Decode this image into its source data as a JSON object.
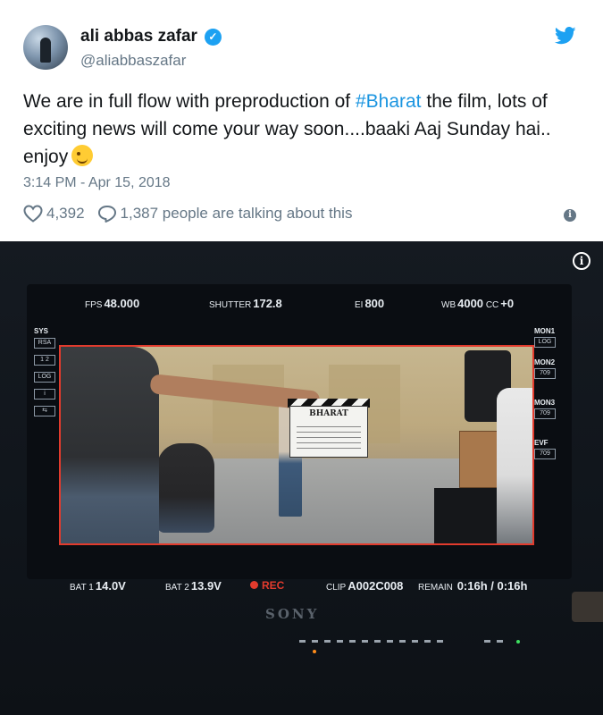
{
  "tweet": {
    "author_name": "ali abbas zafar",
    "handle": "@aliabbaszafar",
    "verified_mark": "✓",
    "text_before": "We are in full flow with preproduction of ",
    "hashtag": "#Bharat",
    "text_after": " the film, lots of exciting news will come your way soon....baaki Aaj Sunday hai.. enjoy",
    "emoji": "winking-face",
    "timestamp": "3:14 PM - Apr 15, 2018",
    "like_count": "4,392",
    "reply_text": "1,387 people are talking about this",
    "info_glyph": "i"
  },
  "photo": {
    "info_glyph": "i",
    "hud_top": {
      "fps_label": "FPS",
      "fps_value": "48.000",
      "shutter_label": "SHUTTER",
      "shutter_value": "172.8",
      "ei_label": "EI",
      "ei_value": "800",
      "wb_label": "WB",
      "wb_value": "4000",
      "cc_label": "CC",
      "cc_value": "+0"
    },
    "side_left": {
      "label": "SYS",
      "boxes": [
        "RSA",
        "1 2",
        "LOG",
        "i",
        "⇆"
      ]
    },
    "side_right": {
      "items": [
        {
          "label": "MON1",
          "box": "LOG"
        },
        {
          "label": "MON2",
          "box": "709"
        },
        {
          "label": "MON3",
          "box": "709"
        },
        {
          "label": "EVF",
          "box": "709"
        }
      ]
    },
    "clapper_title": "BHARAT",
    "hud_bottom": {
      "bat1_label": "BAT 1",
      "bat1_value": "14.0V",
      "bat2_label": "BAT 2",
      "bat2_value": "13.9V",
      "rec_label": "REC",
      "clip_label": "CLIP",
      "clip_value": "A002C008",
      "remain_label": "REMAIN",
      "remain_value": "0:16h / 0:16h"
    },
    "brand": "SONY"
  },
  "colors": {
    "hashtag": "#1b95e0",
    "verified": "#1da1f2",
    "rec": "#e23b2d",
    "frame_border": "#e23b2d"
  },
  "icons": [
    "twitter-bird-icon",
    "verified-badge-icon",
    "heart-icon",
    "reply-bubble-icon",
    "info-icon"
  ]
}
